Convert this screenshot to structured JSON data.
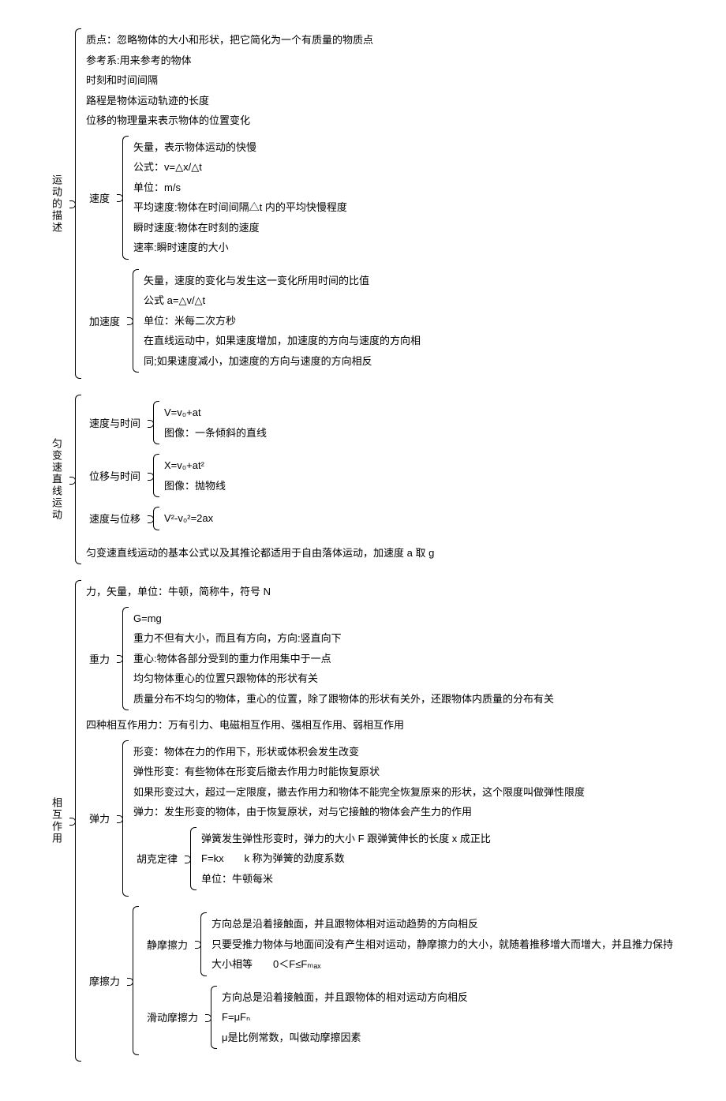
{
  "s1": {
    "title": "运动的描述",
    "direct": [
      "质点：忽略物体的大小和形状，把它简化为一个有质量的物质点",
      "参考系:用来参考的物体",
      "时刻和时间间隔",
      "路程是物体运动轨迹的长度",
      "位移的物理量来表示物体的位置变化"
    ],
    "speed": {
      "label": "速度",
      "items": [
        "矢量，表示物体运动的快慢",
        "公式：v=△x/△t",
        "单位：m/s",
        "平均速度:物体在时间间隔△t 内的平均快慢程度",
        "瞬时速度:物体在时刻的速度",
        "速率:瞬时速度的大小"
      ]
    },
    "accel": {
      "label": "加速度",
      "items": [
        "矢量，速度的变化与发生这一变化所用时间的比值",
        "公式 a=△v/△t",
        "单位：米每二次方秒",
        "在直线运动中，如果速度增加，加速度的方向与速度的方向相",
        "同;如果速度减小，加速度的方向与速度的方向相反"
      ]
    }
  },
  "s2": {
    "title": "匀变速直线运动",
    "vt": {
      "label": "速度与时间",
      "items": [
        "V=v₀+at",
        "图像：一条倾斜的直线"
      ]
    },
    "xt": {
      "label": "位移与时间",
      "items": [
        "X=v₀+at²",
        "图像：抛物线"
      ]
    },
    "vx": {
      "label": "速度与位移",
      "items": [
        "V²-v₀²=2ax"
      ]
    },
    "note": "匀变速直线运动的基本公式以及其推论都适用于自由落体运动，加速度 a 取 g"
  },
  "s3": {
    "title": "相互作用",
    "intro": "力，矢量，单位：牛顿，简称牛，符号 N",
    "gravity": {
      "label": "重力",
      "items": [
        "G=mg",
        "重力不但有大小，而且有方向，方向:竖直向下",
        "重心:物体各部分受到的重力作用集中于一点",
        "均匀物体重心的位置只跟物体的形状有关",
        "质量分布不均匀的物体，重心的位置，除了跟物体的形状有关外，还跟物体内质量的分布有关"
      ]
    },
    "forces4": "四种相互作用力：万有引力、电磁相互作用、强相互作用、弱相互作用",
    "elastic": {
      "label": "弹力",
      "items": [
        "形变：物体在力的作用下，形状或体积会发生改变",
        "弹性形变：有些物体在形变后撤去作用力时能恢复原状",
        "如果形变过大，超过一定限度，撤去作用力和物体不能完全恢复原来的形状，这个限度叫做弹性限度",
        "弹力：发生形变的物体，由于恢复原状，对与它接触的物体会产生力的作用"
      ],
      "hooke": {
        "label": "胡克定律",
        "items": [
          "弹簧发生弹性形变时，弹力的大小 F 跟弹簧伸长的长度 x 成正比",
          "F=kx  k 称为弹簧的劲度系数",
          "单位：牛顿每米"
        ]
      }
    },
    "friction": {
      "label": "摩擦力",
      "static": {
        "label": "静摩擦力",
        "items": [
          "方向总是沿着接触面，并且跟物体相对运动趋势的方向相反",
          "只要受推力物体与地面间没有产生相对运动，静摩擦力的大小，就随着推移增大而增大，并且推力保持",
          "大小相等  0＜F≤Fₘₐₓ"
        ]
      },
      "sliding": {
        "label": "滑动摩擦力",
        "items": [
          "方向总是沿着接触面，并且跟物体的相对运动方向相反",
          "F=μFₙ",
          "μ是比例常数，叫做动摩擦因素"
        ]
      }
    }
  }
}
